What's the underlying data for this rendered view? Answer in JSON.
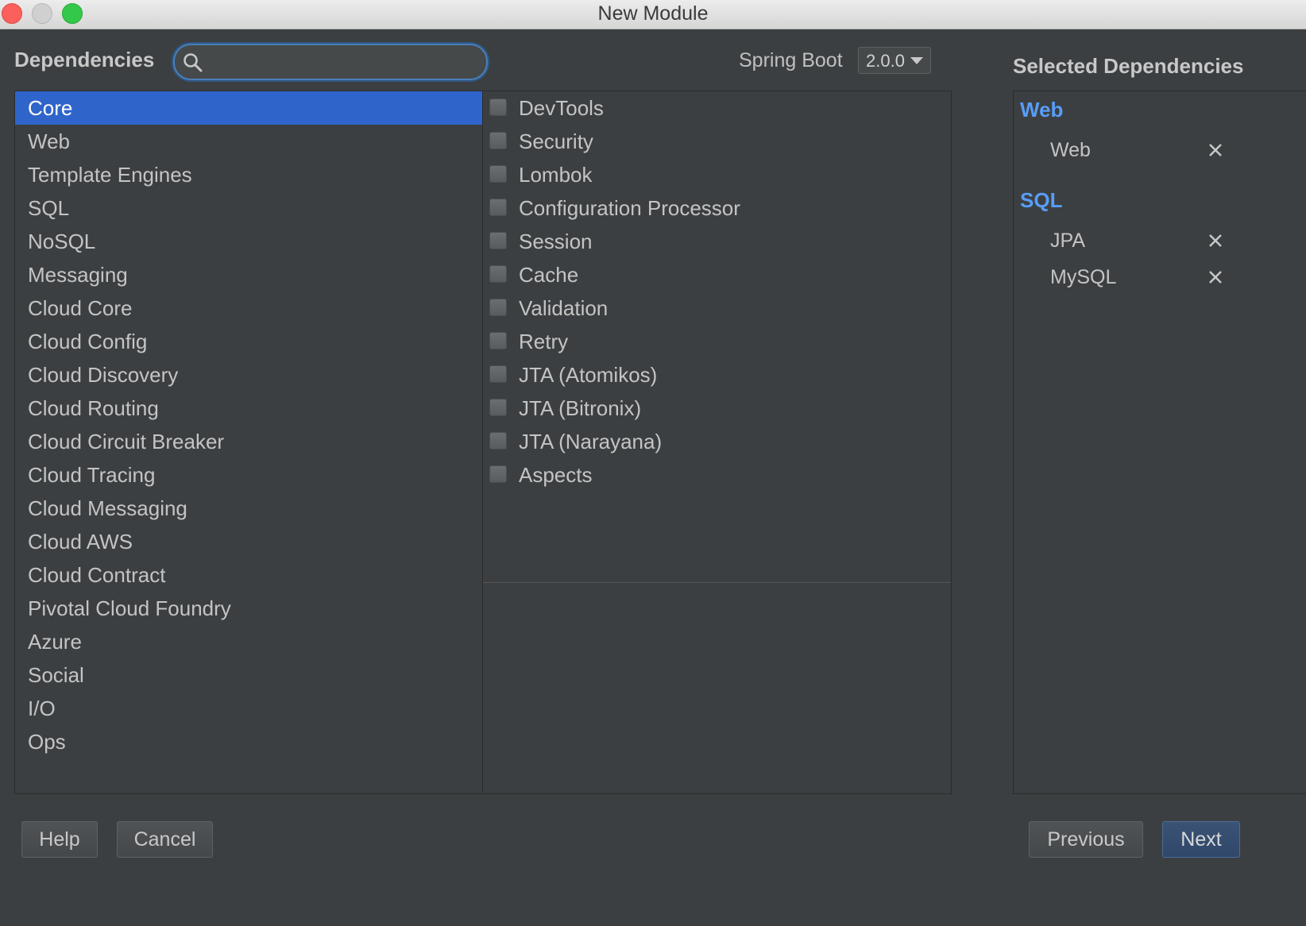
{
  "window": {
    "title": "New Module"
  },
  "header": {
    "dependencies_label": "Dependencies",
    "search": {
      "value": "",
      "placeholder": ""
    },
    "spring_boot_label": "Spring Boot",
    "spring_boot_version": "2.0.0",
    "selected_label": "Selected Dependencies"
  },
  "categories": {
    "selected": "Core",
    "items": [
      "Core",
      "Web",
      "Template Engines",
      "SQL",
      "NoSQL",
      "Messaging",
      "Cloud Core",
      "Cloud Config",
      "Cloud Discovery",
      "Cloud Routing",
      "Cloud Circuit Breaker",
      "Cloud Tracing",
      "Cloud Messaging",
      "Cloud AWS",
      "Cloud Contract",
      "Pivotal Cloud Foundry",
      "Azure",
      "Social",
      "I/O",
      "Ops"
    ]
  },
  "dependencies": {
    "items": [
      "DevTools",
      "Security",
      "Lombok",
      "Configuration Processor",
      "Session",
      "Cache",
      "Validation",
      "Retry",
      "JTA (Atomikos)",
      "JTA (Bitronix)",
      "JTA (Narayana)",
      "Aspects"
    ]
  },
  "selected": {
    "groups": [
      {
        "name": "Web",
        "items": [
          "Web"
        ]
      },
      {
        "name": "SQL",
        "items": [
          "JPA",
          "MySQL"
        ]
      }
    ]
  },
  "buttons": {
    "help": "Help",
    "cancel": "Cancel",
    "previous": "Previous",
    "next": "Next"
  },
  "colors": {
    "selection": "#2f65ca",
    "group_header": "#589df6",
    "background": "#3c3f41"
  }
}
